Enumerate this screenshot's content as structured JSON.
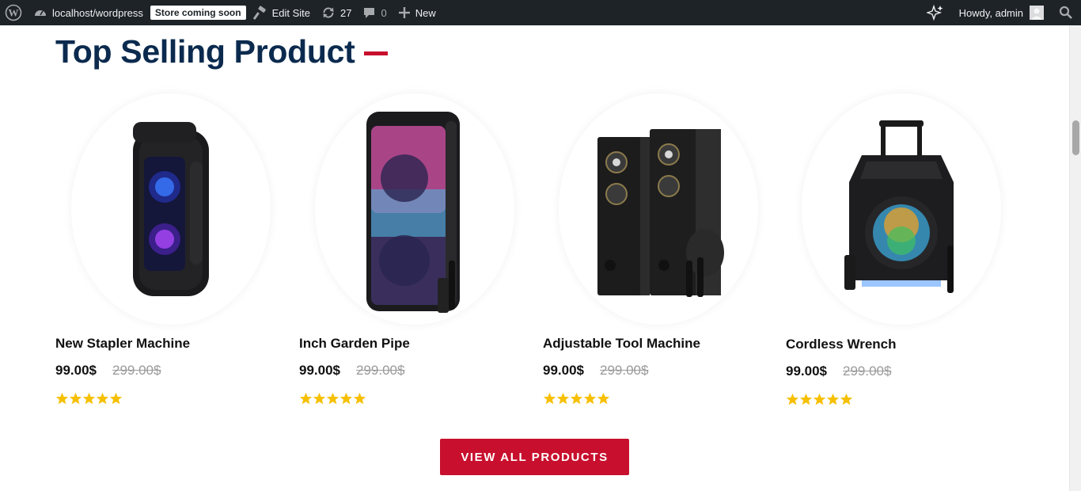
{
  "admin_bar": {
    "site_name": "localhost/wordpress",
    "store_badge": "Store coming soon",
    "edit_site": "Edit Site",
    "updates_count": "27",
    "comments_count": "0",
    "new_label": "New",
    "greeting": "Howdy, admin"
  },
  "section": {
    "title": "Top Selling Product"
  },
  "products": [
    {
      "name": "New Stapler Machine",
      "price": "99.00$",
      "old_price": "299.00$",
      "rating": 5
    },
    {
      "name": "Inch Garden Pipe",
      "price": "99.00$",
      "old_price": "299.00$",
      "rating": 5
    },
    {
      "name": "Adjustable Tool Machine",
      "price": "99.00$",
      "old_price": "299.00$",
      "rating": 5
    },
    {
      "name": "Cordless Wrench",
      "price": "99.00$",
      "old_price": "299.00$",
      "rating": 5
    }
  ],
  "view_all_label": "VIEW ALL PRODUCTS",
  "colors": {
    "admin_bar_bg": "#1d2327",
    "title": "#0b2a4e",
    "accent": "#c8102e",
    "star": "#f6c000"
  },
  "icons": {
    "wordpress": "wordpress-logo-icon",
    "site": "dashboard-icon",
    "edit": "hammer-icon",
    "updates": "refresh-icon",
    "comments": "comment-icon",
    "new": "plus-icon",
    "ai": "sparkle-icon",
    "search": "search-icon"
  }
}
